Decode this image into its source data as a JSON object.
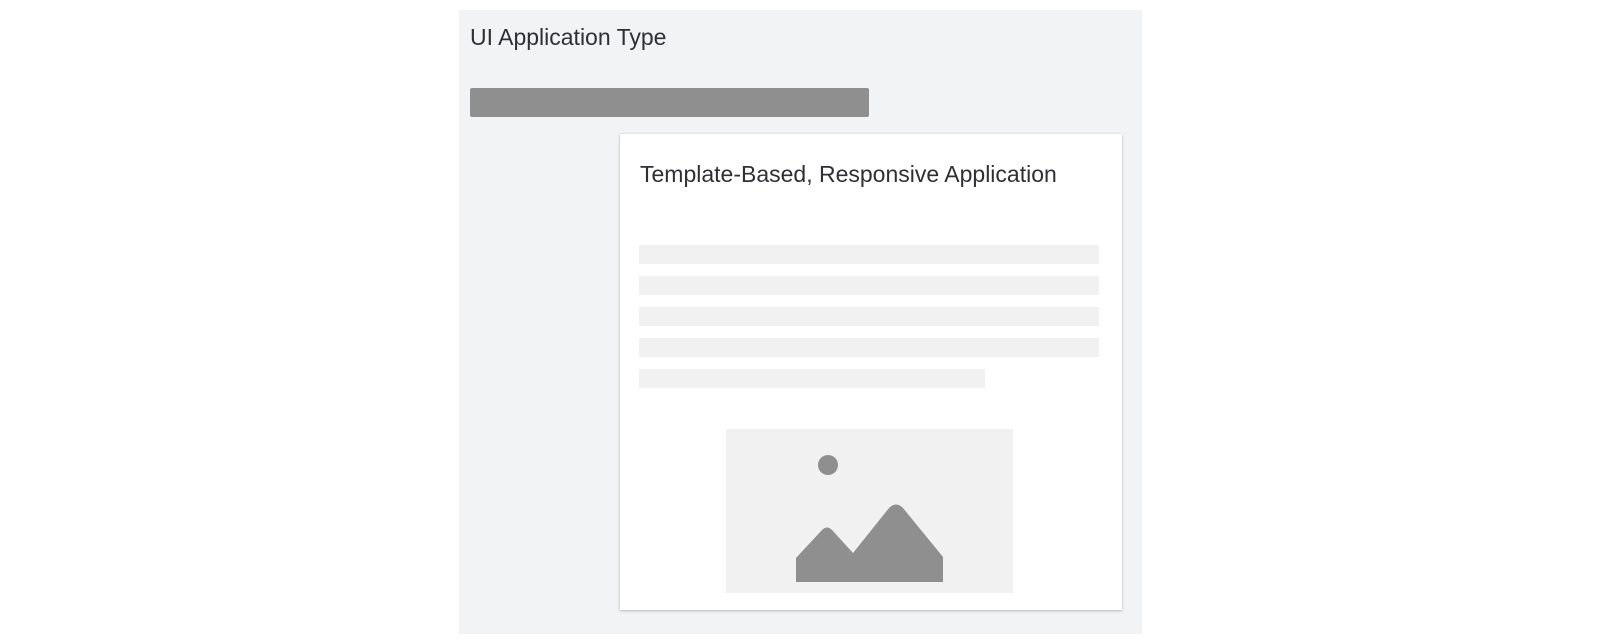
{
  "panel": {
    "title": "UI Application Type",
    "background": "#f2f3f5",
    "bar_color": "#8f8f8f"
  },
  "card": {
    "title": "Template-Based, Responsive Application",
    "skeleton_color": "#f1f1f1",
    "image_icon": "image-placeholder-icon",
    "image_icon_color": "#8f8f8f"
  }
}
